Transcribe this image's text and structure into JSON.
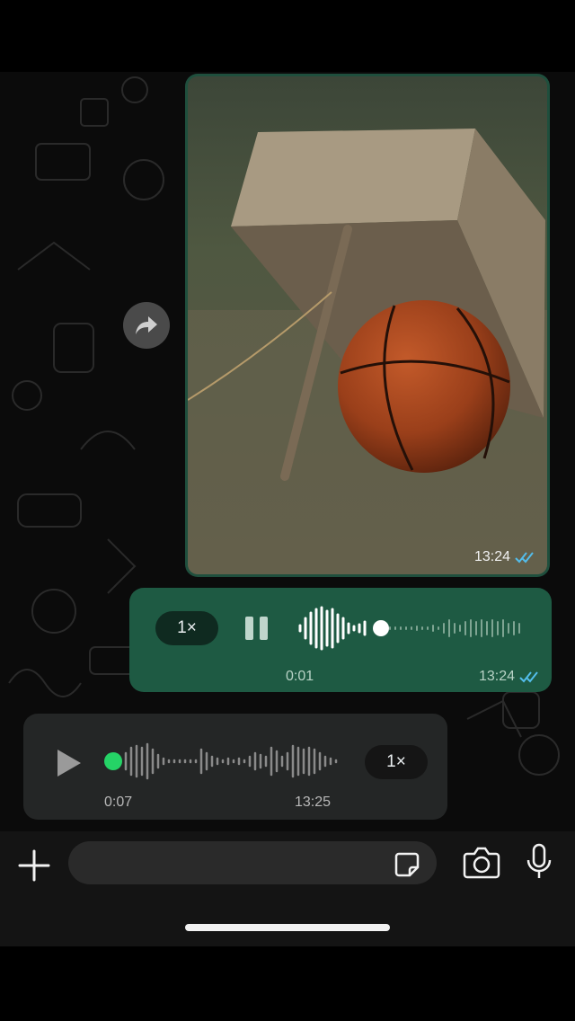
{
  "image_message": {
    "time": "13:24",
    "status": "read"
  },
  "outgoing_voice": {
    "speed": "1×",
    "elapsed": "0:01",
    "time": "13:24",
    "progress": 0.22,
    "status": "read"
  },
  "incoming_voice": {
    "duration": "0:07",
    "time": "13:25",
    "speed": "1×",
    "progress": 0.0
  },
  "composer": {
    "placeholder": ""
  },
  "colors": {
    "outgoing_bubble": "#1e5a43",
    "incoming_bubble": "#242626",
    "read_ticks": "#53bdeb",
    "playhead_green": "#25d366"
  },
  "icons": [
    "forward-icon",
    "pause-icon",
    "play-icon",
    "plus-icon",
    "sticker-icon",
    "camera-icon",
    "mic-icon",
    "double-check-icon"
  ]
}
